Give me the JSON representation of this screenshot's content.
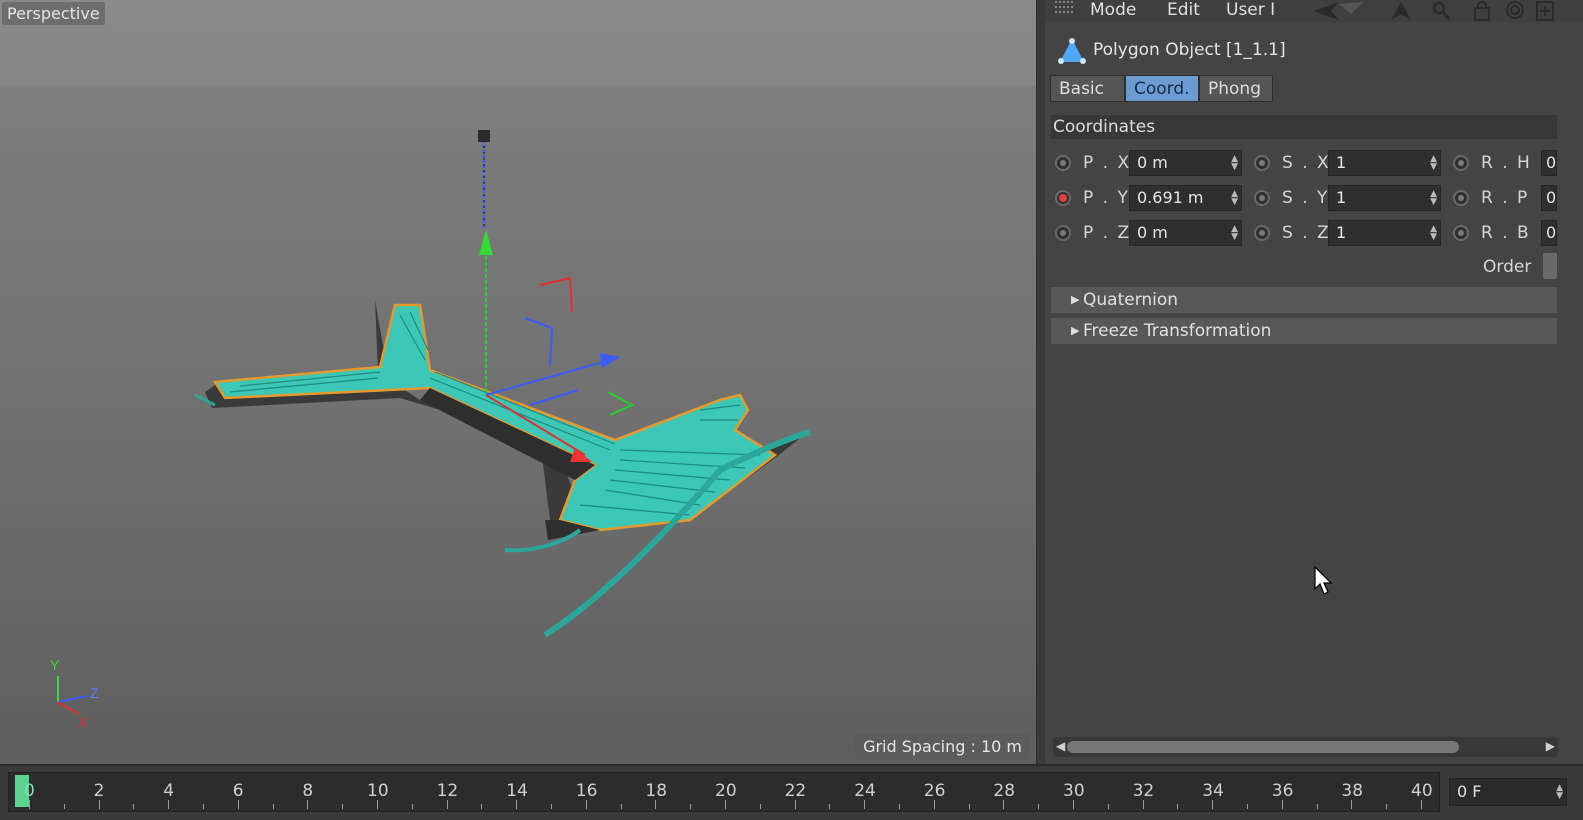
{
  "viewport": {
    "label": "Perspective",
    "grid_spacing": "Grid Spacing : 10 m",
    "axis_labels": {
      "y": "Y",
      "z": "Z",
      "x": "X"
    }
  },
  "attributes": {
    "menu": [
      "Mode",
      "Edit",
      "User I"
    ],
    "object_title": "Polygon Object [1_1.1]",
    "tabs": [
      {
        "label": "Basic",
        "active": false
      },
      {
        "label": "Coord.",
        "active": true
      },
      {
        "label": "Phong",
        "active": false
      }
    ],
    "section": "Coordinates",
    "position": [
      {
        "label": "P . X",
        "value": "0 m",
        "keyed": false
      },
      {
        "label": "P . Y",
        "value": "0.691 m",
        "keyed": true
      },
      {
        "label": "P . Z",
        "value": "0 m",
        "keyed": false
      }
    ],
    "scale": [
      {
        "label": "S . X",
        "value": "1"
      },
      {
        "label": "S . Y",
        "value": "1"
      },
      {
        "label": "S . Z",
        "value": "1"
      }
    ],
    "rotation": [
      {
        "label": "R . H",
        "value": "0"
      },
      {
        "label": "R . P",
        "value": "0"
      },
      {
        "label": "R . B",
        "value": "0"
      }
    ],
    "order_label": "Order",
    "groups": [
      "Quaternion",
      "Freeze Transformation"
    ]
  },
  "timeline": {
    "labels": [
      "0",
      "2",
      "4",
      "6",
      "8",
      "10",
      "12",
      "14",
      "16",
      "18",
      "20",
      "22",
      "24",
      "26",
      "28",
      "30",
      "32",
      "34",
      "36",
      "38",
      "40"
    ],
    "current_frame": "0 F"
  },
  "colors": {
    "accent": "#6b9bd2",
    "key_red": "#e04040",
    "playhead": "#5ad48e",
    "mesh": "#3cc7b6",
    "outline": "#e69a2e"
  }
}
